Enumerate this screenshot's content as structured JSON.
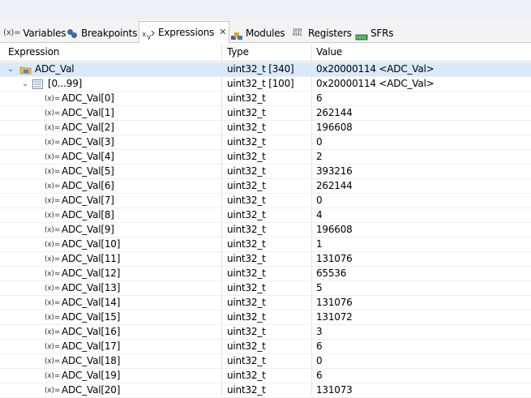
{
  "tabs": [
    {
      "label": "Variables",
      "icon": "variables-icon"
    },
    {
      "label": "Breakpoints",
      "icon": "breakpoints-icon"
    },
    {
      "label": "Expressions",
      "icon": "expressions-icon",
      "active": true
    },
    {
      "label": "Modules",
      "icon": "modules-icon"
    },
    {
      "label": "Registers",
      "icon": "registers-icon"
    },
    {
      "label": "SFRs",
      "icon": "sfrs-icon"
    }
  ],
  "icons": {
    "variable_prefix": "(x)=",
    "registers_glyph_top": "1010",
    "registers_glyph_bottom": "0101",
    "close": "✕",
    "expanded": "⌄"
  },
  "columns": {
    "expression": "Expression",
    "type": "Type",
    "value": "Value"
  },
  "rows": [
    {
      "name": "ADC_Val",
      "type": "uint32_t [340]",
      "value": "0x20000114 <ADC_Val>"
    },
    {
      "name": "[0...99]",
      "type": "uint32_t [100]",
      "value": "0x20000114 <ADC_Val>"
    },
    {
      "name": "ADC_Val[0]",
      "type": "uint32_t",
      "value": "6"
    },
    {
      "name": "ADC_Val[1]",
      "type": "uint32_t",
      "value": "262144"
    },
    {
      "name": "ADC_Val[2]",
      "type": "uint32_t",
      "value": "196608"
    },
    {
      "name": "ADC_Val[3]",
      "type": "uint32_t",
      "value": "0"
    },
    {
      "name": "ADC_Val[4]",
      "type": "uint32_t",
      "value": "2"
    },
    {
      "name": "ADC_Val[5]",
      "type": "uint32_t",
      "value": "393216"
    },
    {
      "name": "ADC_Val[6]",
      "type": "uint32_t",
      "value": "262144"
    },
    {
      "name": "ADC_Val[7]",
      "type": "uint32_t",
      "value": "0"
    },
    {
      "name": "ADC_Val[8]",
      "type": "uint32_t",
      "value": "4"
    },
    {
      "name": "ADC_Val[9]",
      "type": "uint32_t",
      "value": "196608"
    },
    {
      "name": "ADC_Val[10]",
      "type": "uint32_t",
      "value": "1"
    },
    {
      "name": "ADC_Val[11]",
      "type": "uint32_t",
      "value": "131076"
    },
    {
      "name": "ADC_Val[12]",
      "type": "uint32_t",
      "value": "65536"
    },
    {
      "name": "ADC_Val[13]",
      "type": "uint32_t",
      "value": "5"
    },
    {
      "name": "ADC_Val[14]",
      "type": "uint32_t",
      "value": "131076"
    },
    {
      "name": "ADC_Val[15]",
      "type": "uint32_t",
      "value": "131072"
    },
    {
      "name": "ADC_Val[16]",
      "type": "uint32_t",
      "value": "3"
    },
    {
      "name": "ADC_Val[17]",
      "type": "uint32_t",
      "value": "6"
    },
    {
      "name": "ADC_Val[18]",
      "type": "uint32_t",
      "value": "0"
    },
    {
      "name": "ADC_Val[19]",
      "type": "uint32_t",
      "value": "6"
    },
    {
      "name": "ADC_Val[20]",
      "type": "uint32_t",
      "value": "131073"
    }
  ],
  "colors": {
    "selection": "#d9e9fb",
    "tabbar": "#f3f3f3",
    "accent": "#3f69a8"
  }
}
